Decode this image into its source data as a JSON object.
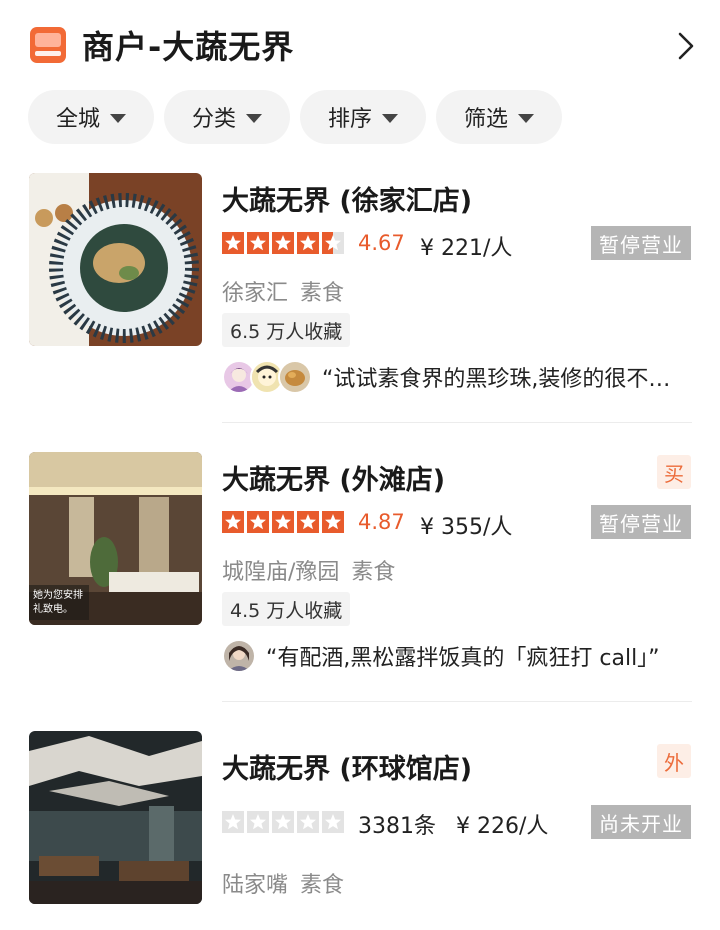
{
  "header": {
    "title": "商户-大蔬无界"
  },
  "filters": [
    {
      "label": "全城"
    },
    {
      "label": "分类"
    },
    {
      "label": "排序"
    },
    {
      "label": "筛选"
    }
  ],
  "colors": {
    "accent": "#e85b2c",
    "star_empty": "#e3e3e3",
    "status_bg": "#b5b5b5"
  },
  "shops": [
    {
      "name": "大蔬无界 (徐家汇店)",
      "stars": 4.5,
      "rating": "4.67",
      "price": "¥ 221/人",
      "status": "暂停营业",
      "badge": "",
      "area": "徐家汇",
      "category": "素食",
      "favorites": "6.5 万人收藏",
      "review": "“试试素食界的黑珍珠,装修的很不…"
    },
    {
      "name": "大蔬无界 (外滩店)",
      "stars": 5,
      "rating": "4.87",
      "price": "¥ 355/人",
      "status": "暂停营业",
      "badge": "买",
      "area": "城隍庙/豫园",
      "category": "素食",
      "favorites": "4.5 万人收藏",
      "review": "“有配酒,黑松露拌饭真的「疯狂打 call」”"
    },
    {
      "name": "大蔬无界 (环球馆店)",
      "stars": 0,
      "reviews": "3381条",
      "price": "¥ 226/人",
      "status": "尚未开业",
      "badge": "外",
      "area": "陆家嘴",
      "category": "素食"
    }
  ]
}
